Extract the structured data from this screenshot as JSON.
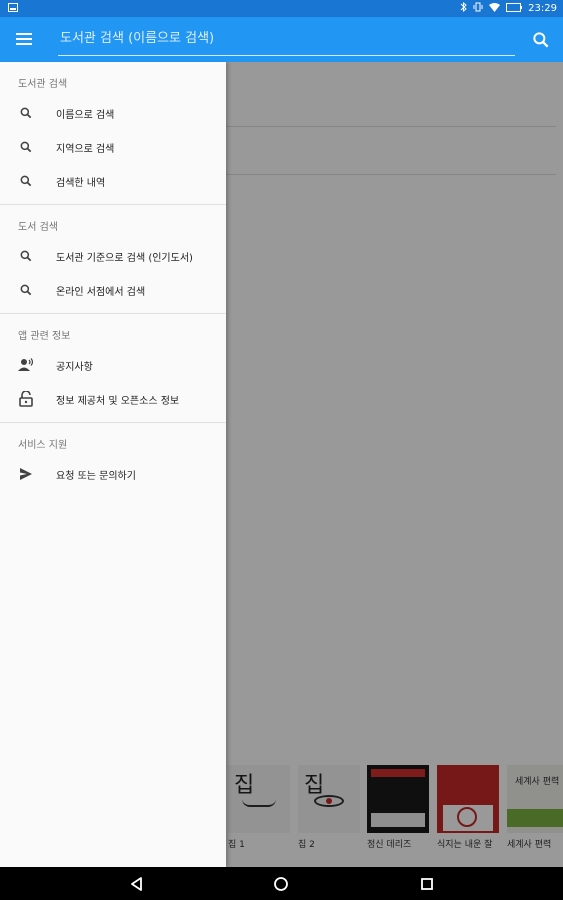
{
  "status_bar": {
    "time": "23:29"
  },
  "app_bar": {
    "search_placeholder": "도서관 검색 (이름으로 검색)"
  },
  "drawer": {
    "sections": [
      {
        "title": "도서관 검색",
        "items": [
          {
            "label": "이름으로 검색",
            "icon": "search-icon"
          },
          {
            "label": "지역으로 검색",
            "icon": "search-icon"
          },
          {
            "label": "검색한 내역",
            "icon": "search-icon"
          }
        ]
      },
      {
        "title": "도서 검색",
        "items": [
          {
            "label": "도서관 기준으로 검색 (인기도서)",
            "icon": "search-icon"
          },
          {
            "label": "온라인 서점에서 검색",
            "icon": "search-icon"
          }
        ]
      },
      {
        "title": "앱 관련 정보",
        "items": [
          {
            "label": "공지사항",
            "icon": "person-announce-icon"
          },
          {
            "label": "정보 제공처 및 오픈소스 정보",
            "icon": "lock-open-icon"
          }
        ]
      },
      {
        "title": "서비스 지원",
        "items": [
          {
            "label": "요청 또는 문의하기",
            "icon": "send-icon"
          }
        ]
      }
    ]
  },
  "books": [
    {
      "label": "집 1",
      "cover_text": "집"
    },
    {
      "label": "집 2",
      "cover_text": "집"
    },
    {
      "label": "정신 데리즈",
      "cover_text": ""
    },
    {
      "label": "식지는 내운 잘",
      "cover_text": ""
    },
    {
      "label": "세계사 편력",
      "cover_text": "세계사 편력"
    }
  ],
  "colors": {
    "primary": "#2196f3",
    "status": "#1976d2",
    "drawer_bg": "#fafafa"
  }
}
